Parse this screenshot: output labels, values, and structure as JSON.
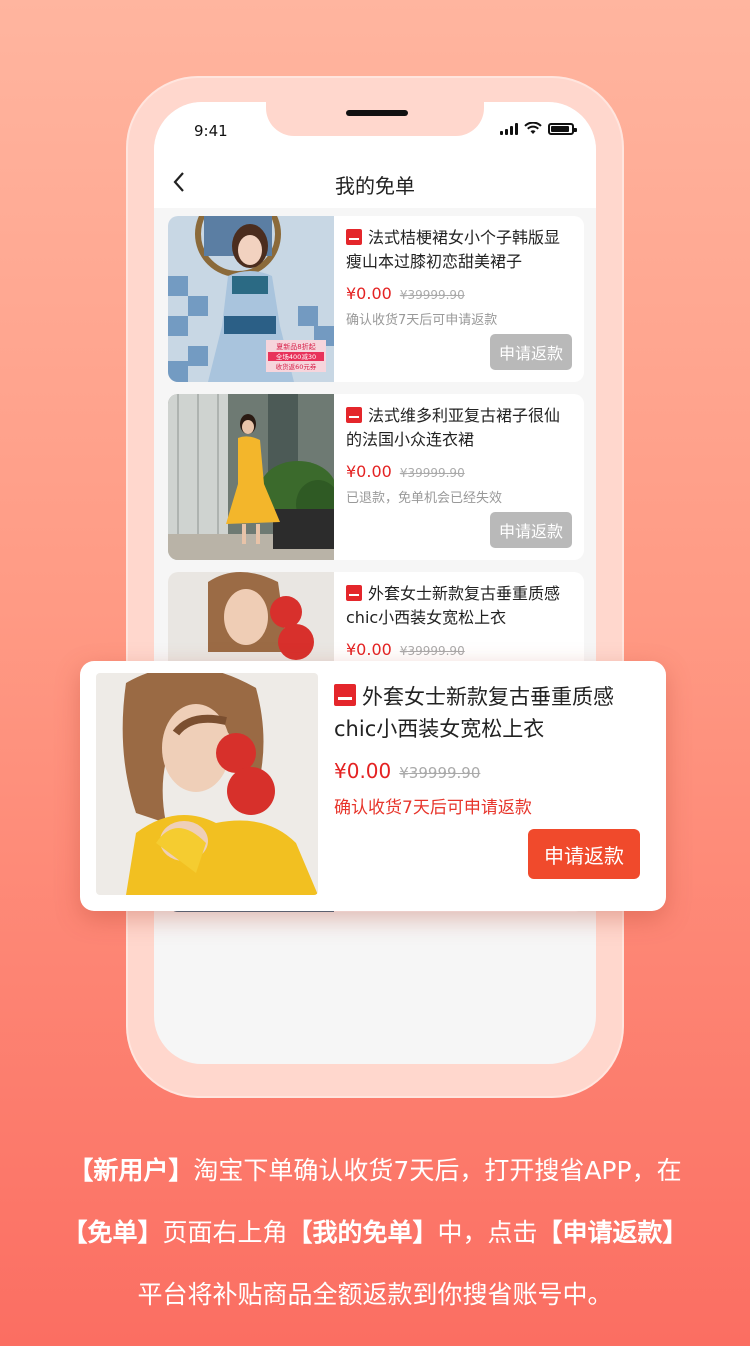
{
  "status": {
    "time": "9:41"
  },
  "nav": {
    "back": "<",
    "title": "我的免单"
  },
  "orders": [
    {
      "title": "法式桔梗裙女小个子韩版显瘦山本过膝初恋甜美裙子",
      "price": "¥0.00",
      "orig_price": "¥39999.90",
      "note": "确认收货7天后可申请返款",
      "button": "申请返款",
      "badge_lines": [
        "夏新品8折起",
        "全场400减30",
        "收货返60元券"
      ]
    },
    {
      "title": "法式维多利亚复古裙子很仙的法国小众连衣裙",
      "price": "¥0.00",
      "orig_price": "¥39999.90",
      "note": "已退款，免单机会已经失效",
      "button": "申请返款"
    },
    {
      "title": "外套女士新款复古垂重质感chic小西装女宽松上衣",
      "price": "¥0.00",
      "orig_price": "¥39999.90"
    }
  ],
  "popup": {
    "title": "外套女士新款复古垂重质感chic小西装女宽松上衣",
    "price": "¥0.00",
    "orig_price": "¥39999.90",
    "note": "确认收货7天后可申请返款",
    "button": "申请返款"
  },
  "caption": {
    "line1_bold": "【新用户】",
    "line1_rest": "淘宝下单确认收货7天后，打开搜省APP，在",
    "line2_bold1": "【免单】",
    "line2_mid": "页面右上角",
    "line2_bold2": "【我的免单】",
    "line2_mid2": "中，点击",
    "line2_bold3": "【申请返款】",
    "line3": "平台将补贴商品全额返款到你搜省账号中。"
  },
  "colors": {
    "accent": "#f04a2c",
    "price": "#e42222",
    "disabled_button": "#b9b9b9"
  }
}
